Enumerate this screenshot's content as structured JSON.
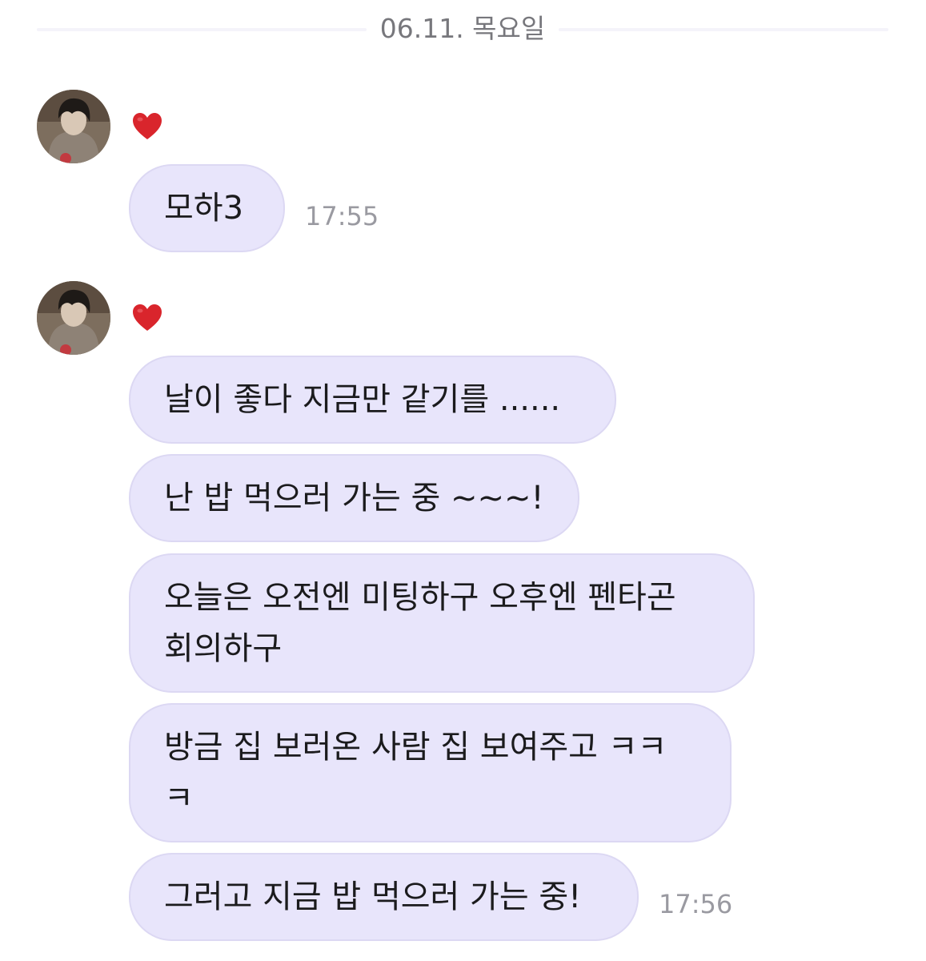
{
  "date_divider": "06.11. 목요일",
  "groups": [
    {
      "reaction_icon": "heart",
      "messages": [
        {
          "text": "모하3",
          "time": "17:55"
        }
      ]
    },
    {
      "reaction_icon": "heart",
      "messages": [
        {
          "text": "날이 좋다 지금만 같기를 ......"
        },
        {
          "text": "난 밥 먹으러 가는 중 ~~~!"
        },
        {
          "text": "오늘은 오전엔 미팅하구 오후엔 펜타곤\n회의하구"
        },
        {
          "text": "방금 집 보러온 사람 집 보여주고 ㅋㅋ\nㅋ"
        },
        {
          "text": "그러고 지금 밥 먹으러 가는 중!",
          "time": "17:56"
        }
      ]
    }
  ],
  "colors": {
    "bubble": "#e8e5fb",
    "bubble_border": "#dcd8f3",
    "heart": "#d9252c",
    "timestamp": "#9a9aa1",
    "date_text": "#77777c"
  }
}
